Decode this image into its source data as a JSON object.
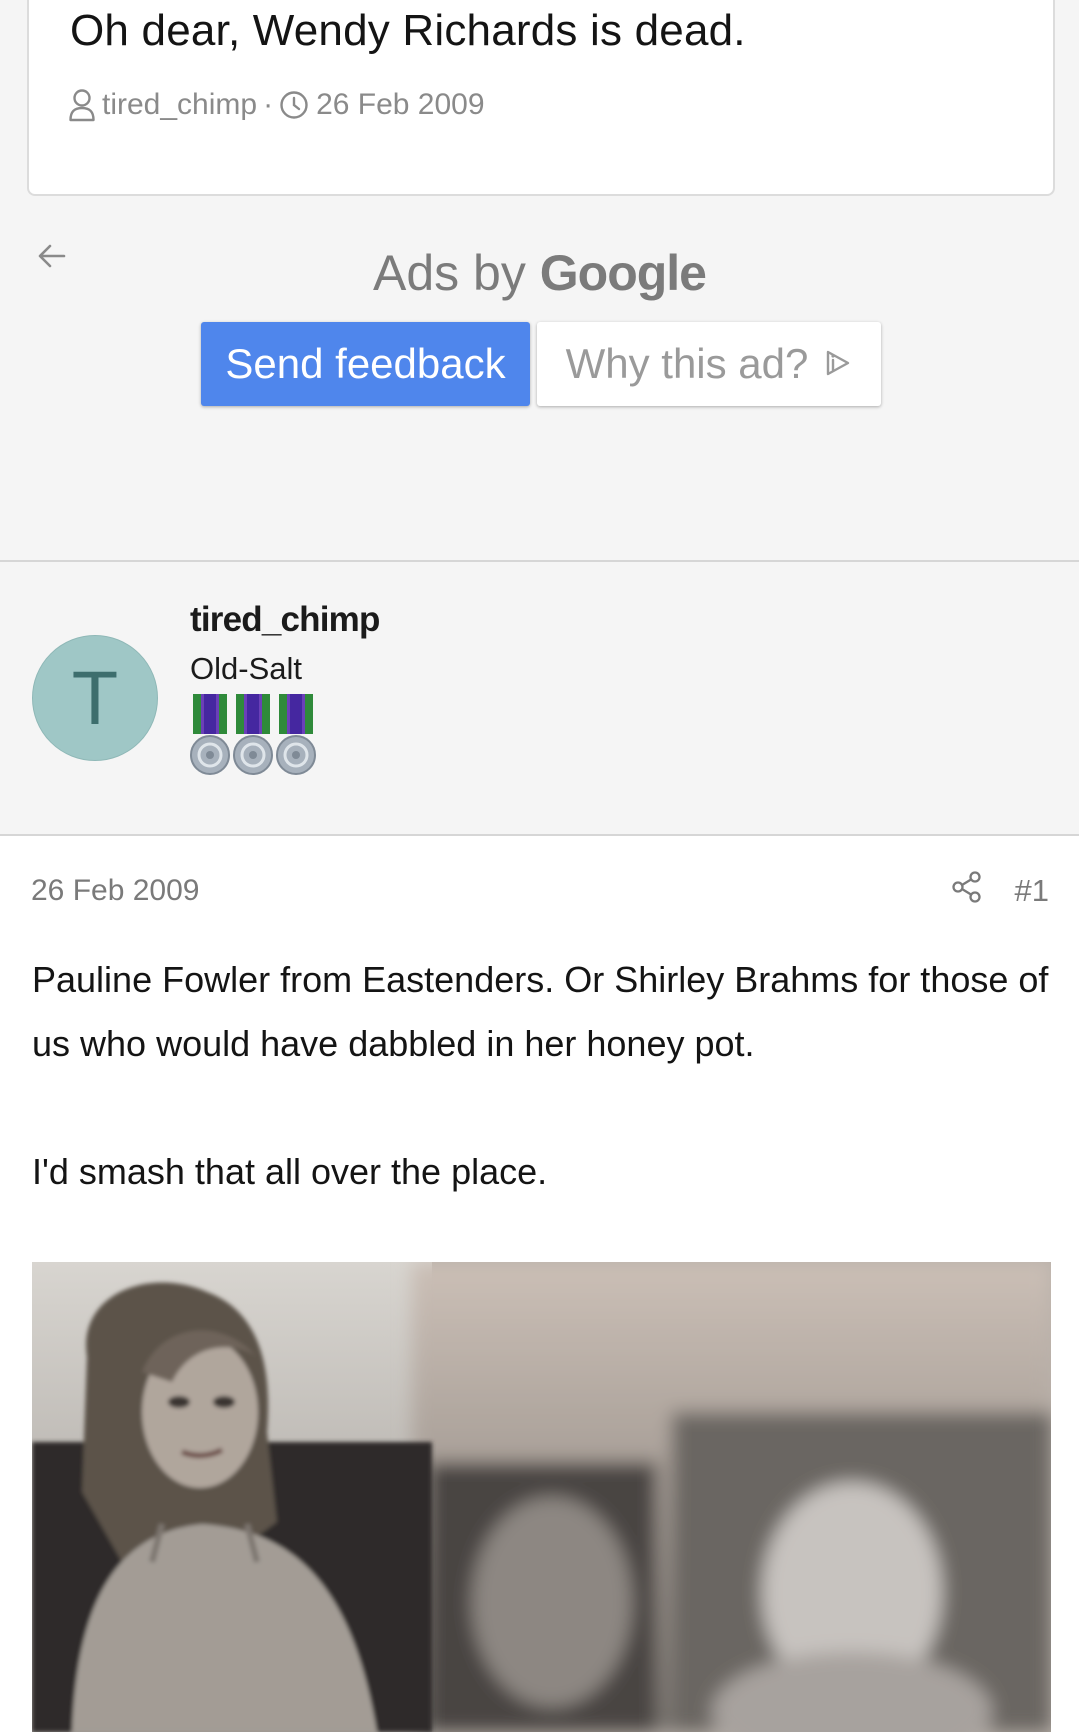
{
  "thread": {
    "title": "Oh dear, Wendy Richards is dead.",
    "author": "tired_chimp",
    "date": "26 Feb 2009",
    "separator": "·"
  },
  "ad": {
    "ads_by": "Ads by",
    "brand": "Google",
    "send_feedback": "Send feedback",
    "why_this_ad": "Why this ad?"
  },
  "user": {
    "avatar_letter": "T",
    "name": "tired_chimp",
    "title": "Old-Salt",
    "medal_count": 3,
    "avatar_color": "#9fc7c6"
  },
  "post": {
    "date": "26 Feb 2009",
    "number": "#1",
    "paragraphs": [
      "Pauline Fowler from Eastenders. Or Shirley Brahms for those of us who would have dabbled in her honey pot.",
      "I'd smash that all over the place."
    ]
  },
  "colors": {
    "accent_blue": "#4f86ec",
    "meta_gray": "#8a8a8a",
    "background": "#f5f5f5"
  },
  "icons": [
    "user-icon",
    "clock-icon",
    "back-arrow-icon",
    "adchoices-icon",
    "share-icon",
    "medal-icon"
  ]
}
